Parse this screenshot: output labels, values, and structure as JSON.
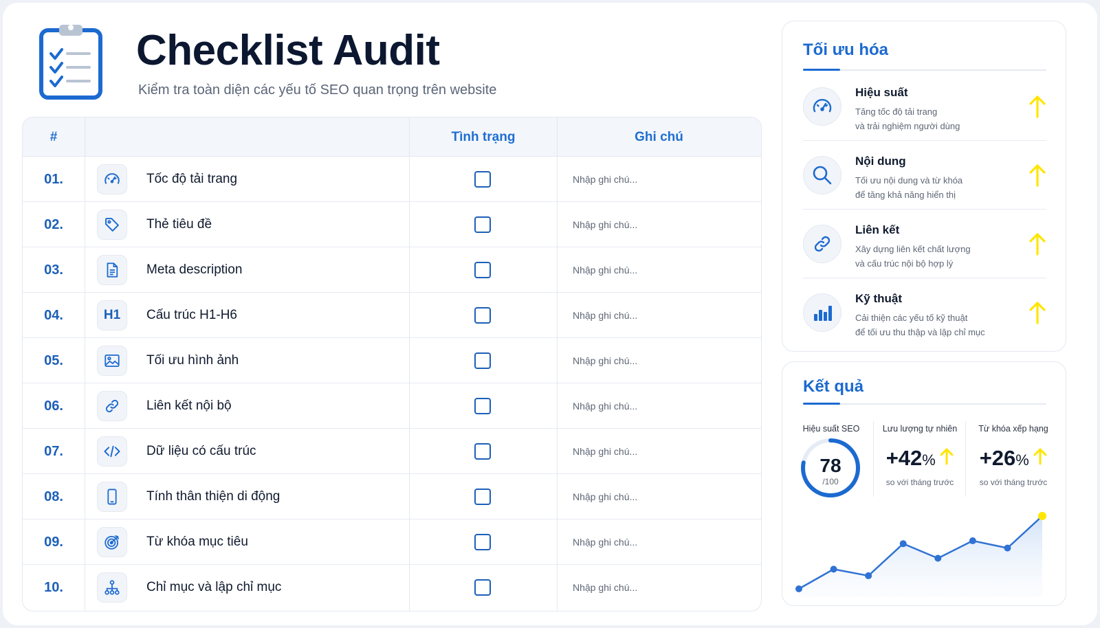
{
  "header": {
    "title": "Checklist Audit",
    "subtitle": "Kiểm tra toàn diện các yếu tố SEO quan trọng trên website"
  },
  "table": {
    "columns": {
      "number": "#",
      "status": "Tình trạng",
      "note": "Ghi chú"
    },
    "note_placeholder": "Nhập ghi chú...",
    "rows": [
      {
        "num": "01.",
        "icon": "speedometer-icon",
        "label": "Tốc độ tải trang",
        "checked": false
      },
      {
        "num": "02.",
        "icon": "tag-icon",
        "label": "Thẻ tiêu đề",
        "checked": false
      },
      {
        "num": "03.",
        "icon": "document-icon",
        "label": "Meta description",
        "checked": false
      },
      {
        "num": "04.",
        "icon": "h1-icon",
        "icon_text": "H1",
        "label": "Cấu trúc H1-H6",
        "checked": false
      },
      {
        "num": "05.",
        "icon": "image-icon",
        "label": "Tối ưu hình ảnh",
        "checked": false
      },
      {
        "num": "06.",
        "icon": "link-icon",
        "label": "Liên kết nội bộ",
        "checked": false
      },
      {
        "num": "07.",
        "icon": "code-icon",
        "label": "Dữ liệu có cấu trúc",
        "checked": false
      },
      {
        "num": "08.",
        "icon": "mobile-icon",
        "label": "Tính thân thiện di động",
        "checked": false
      },
      {
        "num": "09.",
        "icon": "target-icon",
        "label": "Từ khóa mục tiêu",
        "checked": false
      },
      {
        "num": "10.",
        "icon": "sitemap-icon",
        "label": "Chỉ mục và lập chỉ mục",
        "checked": false
      }
    ]
  },
  "optimization": {
    "title": "Tối ưu hóa",
    "items": [
      {
        "icon": "speedometer-icon",
        "name": "Hiệu suất",
        "desc1": "Tăng tốc độ tải trang",
        "desc2": "và trải nghiệm người dùng",
        "trend": "up-arrow-icon"
      },
      {
        "icon": "search-icon",
        "name": "Nội dung",
        "desc1": "Tối ưu nội dung và từ khóa",
        "desc2": "để tăng khả năng hiển thị",
        "trend": "up-arrow-icon"
      },
      {
        "icon": "link-icon",
        "name": "Liên kết",
        "desc1": "Xây dựng liên kết chất lượng",
        "desc2": "và cấu trúc nội bộ hợp lý",
        "trend": "up-arrow-icon"
      },
      {
        "icon": "bar-chart-icon",
        "name": "Kỹ thuật",
        "desc1": "Cải thiện các yếu tố kỹ thuật",
        "desc2": "để tối ưu thu thập và lập chỉ mục",
        "trend": "up-arrow-icon"
      }
    ]
  },
  "results": {
    "title": "Kết quả",
    "seo_score": {
      "label": "Hiệu suất SEO",
      "value": "78",
      "max": "/100",
      "fraction": 0.78
    },
    "organic_traffic": {
      "label": "Lưu lượng tự nhiên",
      "value": "+42",
      "unit": "%",
      "sub": "so với tháng trước"
    },
    "ranking_keywords": {
      "label": "Từ khóa xếp hạng",
      "value": "+26",
      "unit": "%",
      "sub": "so với tháng trước"
    },
    "trend_values": [
      0,
      27,
      18,
      62,
      42,
      66,
      56,
      100
    ]
  },
  "colors": {
    "accent": "#1c6ad0",
    "number": "#1c5fb8",
    "arrow": "#ffe500",
    "text": "#0f1a2e",
    "muted": "#5d6675"
  }
}
